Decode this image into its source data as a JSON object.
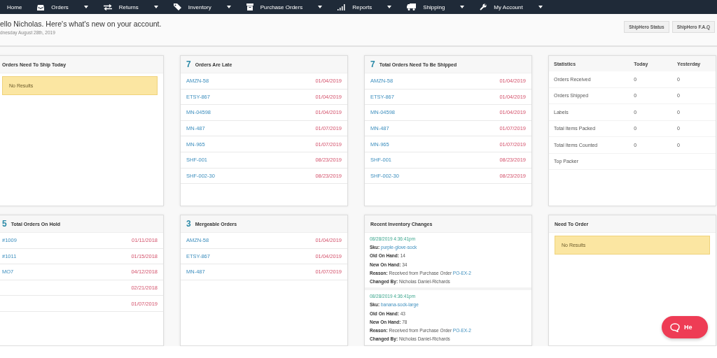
{
  "nav": [
    {
      "label": "Home",
      "dropdown": false
    },
    {
      "label": "Orders",
      "dropdown": true
    },
    {
      "label": "Returns",
      "dropdown": true
    },
    {
      "label": "Inventory",
      "dropdown": true
    },
    {
      "label": "Purchase Orders",
      "dropdown": true
    },
    {
      "label": "Reports",
      "dropdown": true
    },
    {
      "label": "Shipping",
      "dropdown": true
    },
    {
      "label": "My Account",
      "dropdown": true
    }
  ],
  "header": {
    "greeting": "ello Nicholas. Here's what's new on your account.",
    "date": "dnesday August 28th, 2019",
    "buttons": [
      "ShipHero Status",
      "ShipHero F.A.Q"
    ]
  },
  "cards": [
    {
      "kind": "alert",
      "title": "Orders Need To Ship Today",
      "message": "No Results"
    },
    {
      "kind": "orders",
      "count": "7",
      "title": "Orders Are Late",
      "rows": [
        {
          "order": "AMZN-58",
          "date": "01/04/2019"
        },
        {
          "order": "ETSY-867",
          "date": "01/04/2019"
        },
        {
          "order": "MN-04598",
          "date": "01/04/2019"
        },
        {
          "order": "MN-487",
          "date": "01/07/2019"
        },
        {
          "order": "MN-965",
          "date": "01/07/2019"
        },
        {
          "order": "SHF-001",
          "date": "08/23/2019"
        },
        {
          "order": "SHF-002-30",
          "date": "08/23/2019"
        }
      ]
    },
    {
      "kind": "orders",
      "count": "7",
      "title": "Total Orders Need To Be Shipped",
      "rows": [
        {
          "order": "AMZN-58",
          "date": "01/04/2019"
        },
        {
          "order": "ETSY-867",
          "date": "01/04/2019"
        },
        {
          "order": "MN-04598",
          "date": "01/04/2019"
        },
        {
          "order": "MN-487",
          "date": "01/07/2019"
        },
        {
          "order": "MN-965",
          "date": "01/07/2019"
        },
        {
          "order": "SHF-001",
          "date": "08/23/2019"
        },
        {
          "order": "SHF-002-30",
          "date": "08/23/2019"
        }
      ]
    },
    {
      "kind": "stats",
      "columns": [
        "Statistics",
        "Today",
        "Yesterday"
      ],
      "rows": [
        [
          "Orders Received",
          "0",
          "0"
        ],
        [
          "Orders Shipped",
          "0",
          "0"
        ],
        [
          "Labels",
          "0",
          "0"
        ],
        [
          "Total Items Packed",
          "0",
          "0"
        ],
        [
          "Total Items Counted",
          "0",
          "0"
        ],
        [
          "Top Packer"
        ]
      ]
    },
    {
      "kind": "orders",
      "count": "5",
      "title": "Total Orders On Hold",
      "rows": [
        {
          "order": "#1009",
          "date": "01/11/2018"
        },
        {
          "order": "#1011",
          "date": "01/15/2018"
        },
        {
          "order": "MO7",
          "date": "04/12/2018"
        },
        {
          "date": "02/21/2018"
        },
        {
          "date": "01/07/2019"
        }
      ]
    },
    {
      "kind": "orders",
      "count": "3",
      "title": "Mergeable Orders",
      "rows": [
        {
          "order": "AMZN-58",
          "date": "01/04/2019"
        },
        {
          "order": "ETSY-867",
          "date": "01/04/2019"
        },
        {
          "order": "MN-487",
          "date": "01/07/2019"
        }
      ]
    },
    {
      "kind": "inventory",
      "title": "Recent Inventory Changes",
      "entries": [
        {
          "time": "08/28/2019 4:36:41pm",
          "lines": [
            {
              "label": "Sku:",
              "link": "purple-glove-sock"
            },
            {
              "label": "Old On Hand:",
              "value": "14"
            },
            {
              "label": "New On Hand:",
              "value": "34"
            },
            {
              "label": "Reason:",
              "value": "Received from Purchase Order",
              "link": "PO-EX-2"
            },
            {
              "label": "Changed By:",
              "value": "Nicholas Daniel-Richards"
            }
          ]
        },
        {
          "time": "08/28/2019 4:36:41pm",
          "lines": [
            {
              "label": "Sku:",
              "link": "banana-sock-large"
            },
            {
              "label": "Old On Hand:",
              "value": "43"
            },
            {
              "label": "New On Hand:",
              "value": "78"
            },
            {
              "label": "Reason:",
              "value": "Received from Purchase Order",
              "link": "PO-EX-2"
            },
            {
              "label": "Changed By:",
              "value": "Nicholas Daniel-Richards"
            }
          ]
        }
      ]
    },
    {
      "kind": "alert",
      "title": "Need To Order",
      "message": "No Results"
    }
  ],
  "help": {
    "label": "He"
  }
}
